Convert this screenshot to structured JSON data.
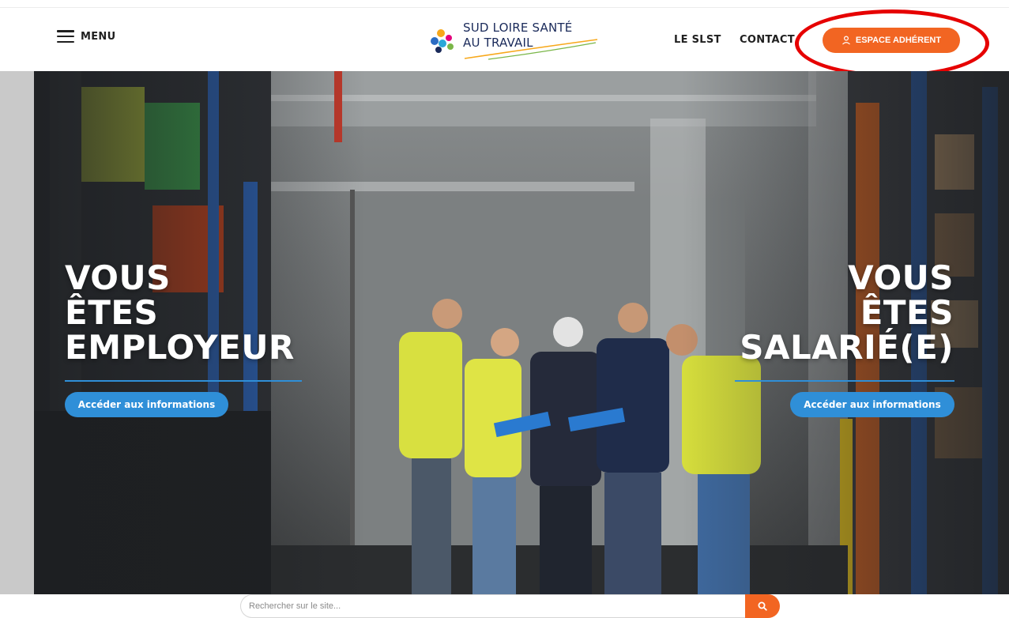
{
  "header": {
    "menu_label": "MENU",
    "logo_line1": "SUD LOIRE SANTÉ",
    "logo_line2": "AU TRAVAIL",
    "nav": [
      {
        "label": "LE SLST"
      },
      {
        "label": "CONTACT"
      }
    ],
    "espace_label": "ESPACE ADHÉRENT"
  },
  "hero": {
    "left": {
      "title_lines": [
        "VOUS",
        "ÊTES",
        "EMPLOYEUR"
      ],
      "button_label": "Accéder aux informations"
    },
    "right": {
      "title_lines": [
        "VOUS",
        "ÊTES",
        "SALARIÉ(E)"
      ],
      "button_label": "Accéder aux informations"
    }
  },
  "search": {
    "placeholder": "Rechercher sur le site..."
  },
  "colors": {
    "accent_orange": "#f26522",
    "accent_blue": "#2f8fd8",
    "annotation_red": "#e60000"
  },
  "icons": [
    "menu-icon",
    "user-icon",
    "search-icon"
  ]
}
